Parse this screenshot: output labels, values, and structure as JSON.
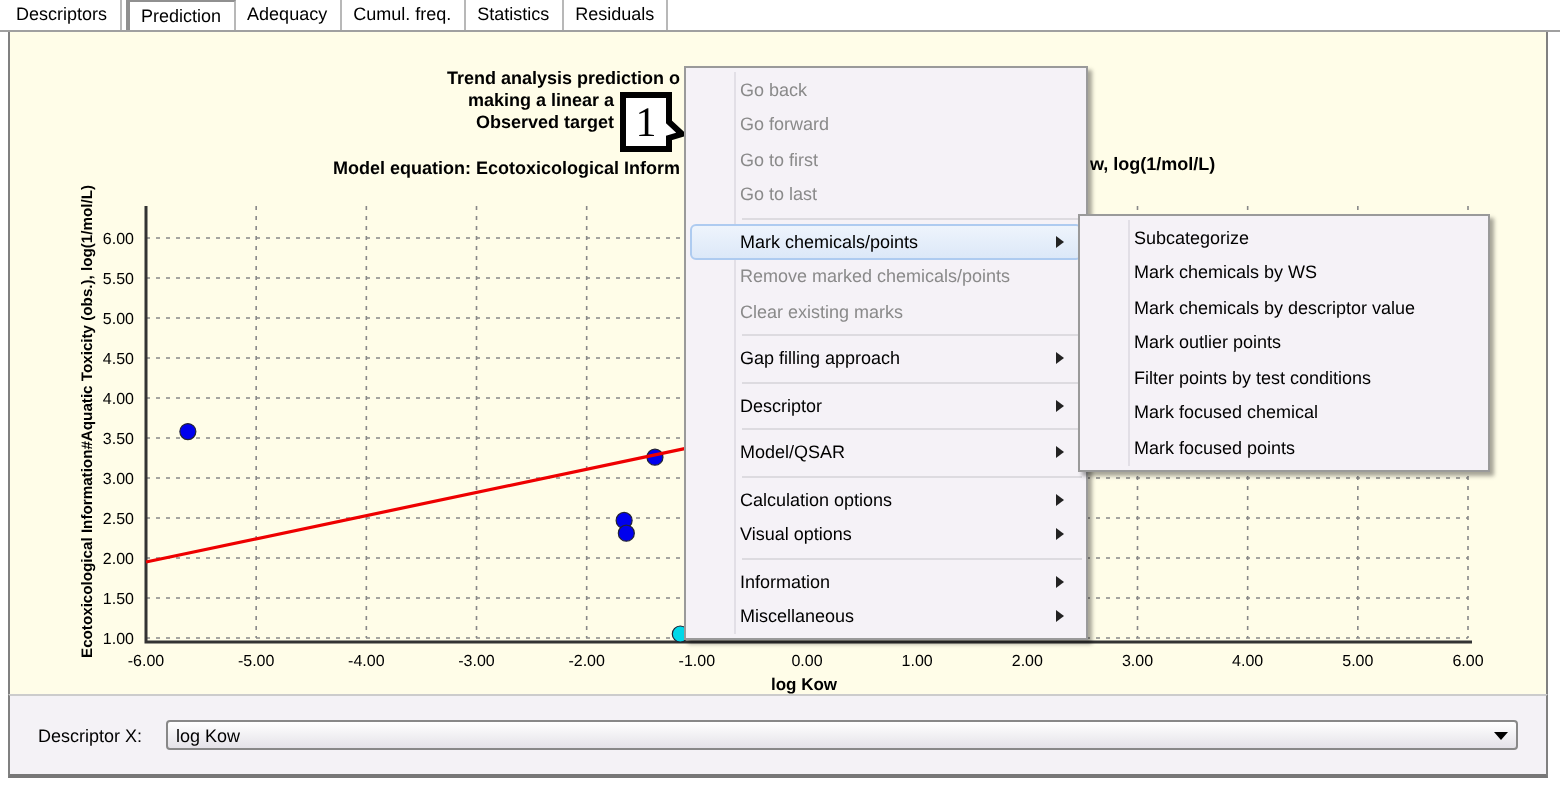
{
  "tabs": [
    {
      "label": "Descriptors",
      "selected": false
    },
    {
      "label": "Prediction",
      "selected": true
    },
    {
      "label": "Adequacy",
      "selected": false
    },
    {
      "label": "Cumul. freq.",
      "selected": false
    },
    {
      "label": "Statistics",
      "selected": false
    },
    {
      "label": "Residuals",
      "selected": false
    }
  ],
  "chart": {
    "title_lines": [
      "Trend analysis prediction o",
      "making a linear a",
      "Observed target"
    ],
    "model_equation": "Model equation:  Ecotoxicological Inform",
    "model_equation_tail": "w,  log(1/mol/L)",
    "chart_data": {
      "type": "scatter",
      "xlabel": "log Kow",
      "ylabel": "Ecotoxicological Information#Aquatic Toxicity (obs.), log(1/mol/L)",
      "grid": true,
      "xlim": [
        -6,
        6
      ],
      "ylim": [
        1,
        6.4
      ],
      "xticks": [
        {
          "value": -6,
          "label": "-6.00"
        },
        {
          "value": -5,
          "label": "-5.00"
        },
        {
          "value": -4,
          "label": "-4.00"
        },
        {
          "value": -3,
          "label": "-3.00"
        },
        {
          "value": -2,
          "label": "-2.00"
        },
        {
          "value": -1,
          "label": "-1.00"
        },
        {
          "value": 0,
          "label": "0.00"
        },
        {
          "value": 1,
          "label": "1.00"
        },
        {
          "value": 2,
          "label": "2.00"
        },
        {
          "value": 3,
          "label": "3.00"
        },
        {
          "value": 4,
          "label": "4.00"
        },
        {
          "value": 5,
          "label": "5.00"
        },
        {
          "value": 6,
          "label": "6.00"
        }
      ],
      "yticks": [
        {
          "value": 1,
          "label": "1.00"
        },
        {
          "value": 1.5,
          "label": "1.50"
        },
        {
          "value": 2,
          "label": "2.00"
        },
        {
          "value": 2.5,
          "label": "2.50"
        },
        {
          "value": 3,
          "label": "3.00"
        },
        {
          "value": 3.5,
          "label": "3.50"
        },
        {
          "value": 4,
          "label": "4.00"
        },
        {
          "value": 4.5,
          "label": "4.50"
        },
        {
          "value": 5,
          "label": "5.00"
        },
        {
          "value": 5.5,
          "label": "5.50"
        },
        {
          "value": 6,
          "label": "6.00"
        }
      ],
      "series": [
        {
          "type": "scatter",
          "color": "#0000ee",
          "x": [
            -5.62,
            -1.66,
            -1.64,
            -1.38
          ],
          "values": [
            3.58,
            2.47,
            2.31,
            3.26
          ]
        },
        {
          "type": "scatter",
          "color": "#00d8e8",
          "x": [
            -1.15
          ],
          "values": [
            1.05
          ]
        },
        {
          "type": "line",
          "color": "#ee0000",
          "x": [
            -6,
            -1.1
          ],
          "values": [
            1.95,
            3.37
          ]
        }
      ]
    }
  },
  "callout": {
    "text": "1"
  },
  "context_menu": {
    "items": [
      {
        "kind": "item",
        "label": "Go back",
        "disabled": true,
        "submenu": false,
        "selected": false
      },
      {
        "kind": "item",
        "label": "Go forward",
        "disabled": true,
        "submenu": false,
        "selected": false
      },
      {
        "kind": "item",
        "label": "Go to first",
        "disabled": true,
        "submenu": false,
        "selected": false
      },
      {
        "kind": "item",
        "label": "Go to last",
        "disabled": true,
        "submenu": false,
        "selected": false
      },
      {
        "kind": "separator"
      },
      {
        "kind": "item",
        "label": "Mark chemicals/points",
        "disabled": false,
        "submenu": true,
        "selected": true
      },
      {
        "kind": "item",
        "label": "Remove marked chemicals/points",
        "disabled": true,
        "submenu": false,
        "selected": false
      },
      {
        "kind": "item",
        "label": "Clear existing marks",
        "disabled": true,
        "submenu": false,
        "selected": false
      },
      {
        "kind": "separator"
      },
      {
        "kind": "item",
        "label": "Gap filling approach",
        "disabled": false,
        "submenu": true,
        "selected": false
      },
      {
        "kind": "separator"
      },
      {
        "kind": "item",
        "label": "Descriptor",
        "disabled": false,
        "submenu": true,
        "selected": false
      },
      {
        "kind": "separator"
      },
      {
        "kind": "item",
        "label": "Model/QSAR",
        "disabled": false,
        "submenu": true,
        "selected": false
      },
      {
        "kind": "separator"
      },
      {
        "kind": "item",
        "label": "Calculation options",
        "disabled": false,
        "submenu": true,
        "selected": false
      },
      {
        "kind": "item",
        "label": "Visual options",
        "disabled": false,
        "submenu": true,
        "selected": false
      },
      {
        "kind": "separator"
      },
      {
        "kind": "item",
        "label": "Information",
        "disabled": false,
        "submenu": true,
        "selected": false
      },
      {
        "kind": "item",
        "label": "Miscellaneous",
        "disabled": false,
        "submenu": true,
        "selected": false
      }
    ],
    "submenu": [
      {
        "label": "Subcategorize"
      },
      {
        "label": "Mark chemicals by WS"
      },
      {
        "label": "Mark chemicals by descriptor value"
      },
      {
        "label": "Mark outlier points"
      },
      {
        "label": "Filter points by test conditions"
      },
      {
        "label": "Mark focused chemical"
      },
      {
        "label": "Mark focused points"
      }
    ]
  },
  "descriptor_x": {
    "label": "Descriptor X:",
    "value": "log Kow"
  }
}
